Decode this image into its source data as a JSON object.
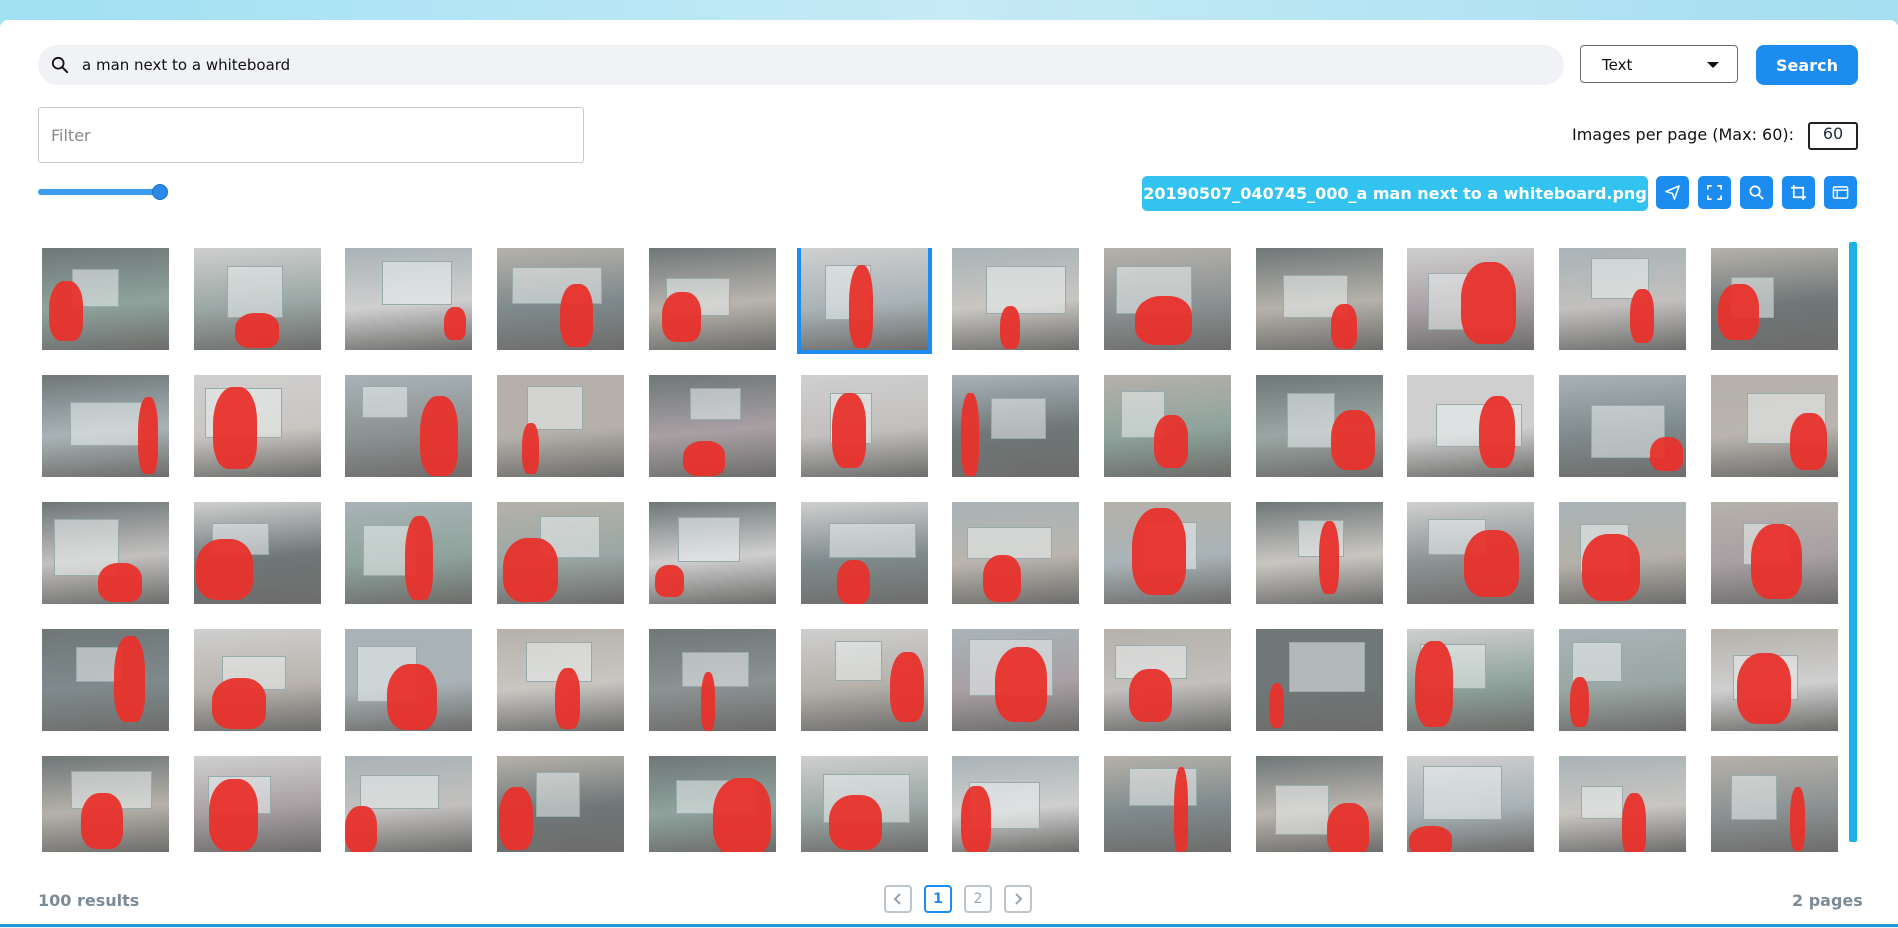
{
  "search": {
    "query": "a man next to a whiteboard",
    "mode": "Text",
    "button_label": "Search"
  },
  "filter": {
    "placeholder": "Filter"
  },
  "images_per_page": {
    "label": "Images per page (Max: 60):",
    "value": "60"
  },
  "selected_file": "20190507_040745_000_a man next to a whiteboard.png",
  "toolbar": {
    "icons": [
      "send-icon",
      "fullscreen-icon",
      "search-icon",
      "crop-icon",
      "panel-icon"
    ]
  },
  "gallery": {
    "rows": 5,
    "columns": 12,
    "selected_index": 5
  },
  "footer": {
    "results": "100 results",
    "pages_label": "2 pages",
    "page_buttons": [
      "1",
      "2"
    ],
    "current_page": "1"
  },
  "colors": {
    "accent": "#1c8cf0",
    "badge": "#33c3f0",
    "highlight": "#e8312c"
  }
}
